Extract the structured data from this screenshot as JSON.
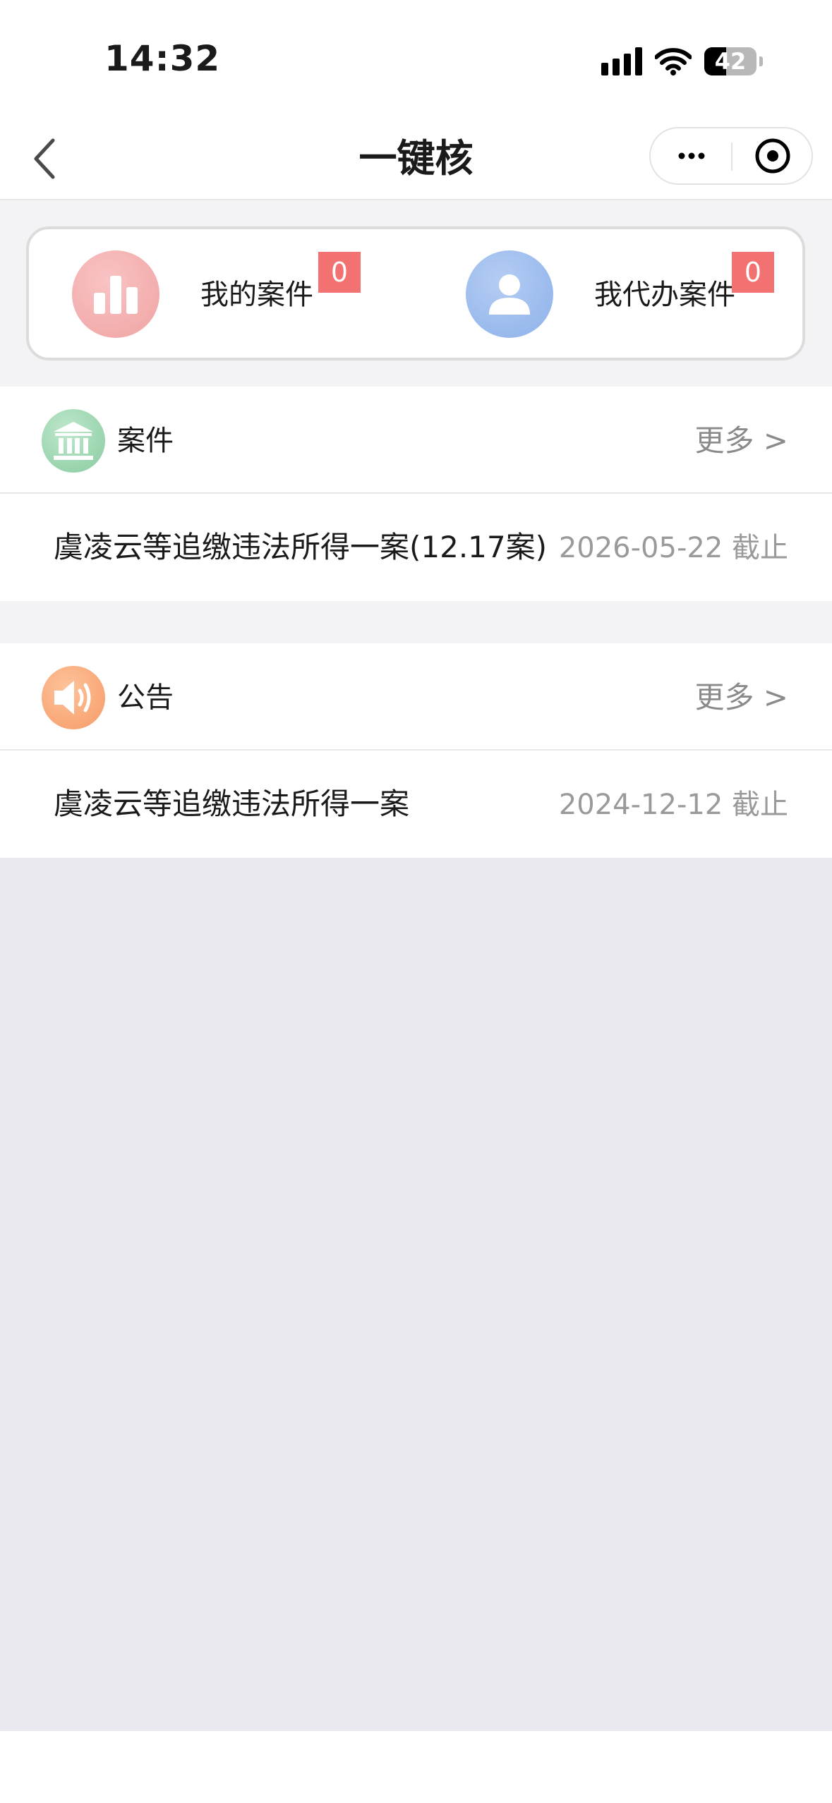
{
  "status_bar": {
    "time": "14:32",
    "battery": "42",
    "battery_level": 0.42,
    "icons": [
      "signal-icon",
      "wifi-icon",
      "battery-icon"
    ]
  },
  "nav": {
    "title": "一键核",
    "back_icon": "chevron-left-icon",
    "more_icon": "ellipsis-icon",
    "close_icon": "target-circle-icon"
  },
  "summary": {
    "my_cases": {
      "label": "我的案件",
      "count": "0",
      "icon": "bar-chart-icon",
      "color": "#f2a0a0"
    },
    "agent_cases": {
      "label": "我代办案件",
      "count": "0",
      "icon": "user-icon",
      "color": "#8fb3ec"
    },
    "badge_color": "#f27171"
  },
  "cases_section": {
    "title": "案件",
    "more": "更多 >",
    "icon": "bank-icon",
    "icon_color": "#8fd2a8",
    "items": [
      {
        "title": "虞凌云等追缴违法所得一案(12.17案)",
        "date": "2026-05-22 截止"
      }
    ]
  },
  "notice_section": {
    "title": "公告",
    "more": "更多 >",
    "icon": "speaker-icon",
    "icon_color": "#f9a370",
    "items": [
      {
        "title": "虞凌云等追缴违法所得一案",
        "date": "2024-12-12 截止"
      }
    ]
  }
}
